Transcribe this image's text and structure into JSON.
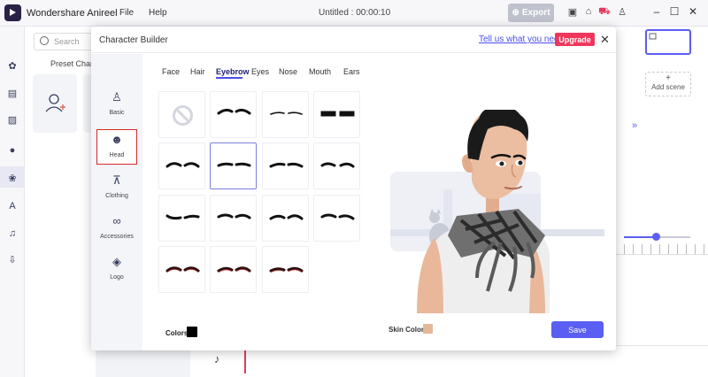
{
  "app": {
    "name": "Wondershare Anireel",
    "menu": [
      "File",
      "Help"
    ],
    "doc_title": "Untitled : 00:00:10",
    "export_label": "Export"
  },
  "background": {
    "search_placeholder": "Search",
    "preset_tab": "Preset Characte",
    "add_scene": "Add scene"
  },
  "modal": {
    "title": "Character Builder",
    "feedback_link": "Tell us what you need",
    "upgrade_label": "Upgrade",
    "categories": [
      {
        "label": "Basic",
        "icon": "person-icon"
      },
      {
        "label": "Head",
        "icon": "head-icon",
        "active": true
      },
      {
        "label": "Clothing",
        "icon": "shirt-icon"
      },
      {
        "label": "Accessories",
        "icon": "glasses-icon"
      },
      {
        "label": "Logo",
        "icon": "logo-icon"
      }
    ],
    "tabs": [
      "Face",
      "Hair",
      "Eyebrow",
      "Eyes",
      "Nose",
      "Mouth",
      "Ears"
    ],
    "active_tab": "Eyebrow",
    "selected_eyebrow_index": 5,
    "colors_label": "Colors",
    "color_value": "#000000",
    "skin_label": "Skin Color",
    "skin_value": "#e5b89a",
    "save_label": "Save"
  }
}
